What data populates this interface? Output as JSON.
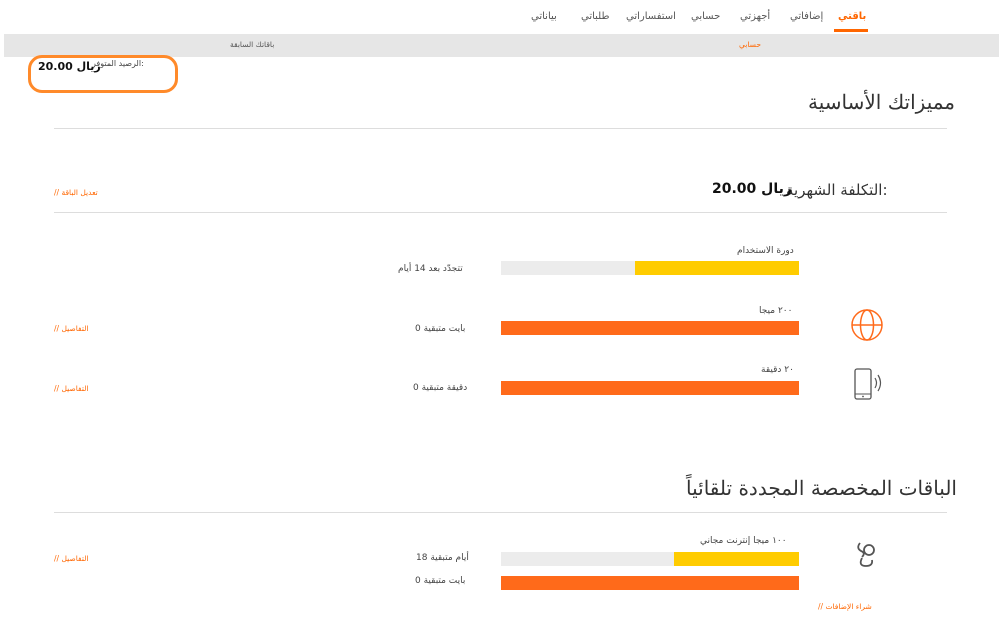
{
  "nav": {
    "tabs": [
      {
        "label": "باقتي",
        "active": true
      },
      {
        "label": "إضافاتي",
        "active": false
      },
      {
        "label": "أجهزتي",
        "active": false
      },
      {
        "label": "حسابي",
        "active": false
      },
      {
        "label": "استفساراتي",
        "active": false
      },
      {
        "label": "طلباتي",
        "active": false
      },
      {
        "label": "بياناتي",
        "active": false
      }
    ],
    "accent_color": "#ff6600"
  },
  "subnav": {
    "account": "حسابي",
    "previous_plans": "باقاتك السابقة"
  },
  "balance": {
    "label": "الرصيد المتوفر:",
    "value": "20.00 ريال"
  },
  "basic": {
    "title": "مميزاتك الأساسية",
    "monthly_cost_label": "التكلفة الشهرية:",
    "monthly_cost_value": "20.00 ريال",
    "edit_link": "// تعديل الباقة",
    "cycle": {
      "title": "دورة الاستخدام",
      "remaining": "تتجدّد بعد 14 أيام",
      "fill_fraction": 0.55,
      "fill_color": "#ffcc00"
    },
    "items": [
      {
        "icon": "globe-icon",
        "title": "٢٠٠ ميجا",
        "remaining": "0 بايت متبقية",
        "details": "// التفاصيل",
        "fill_fraction": 1.0,
        "fill_color": "#ff6a1a"
      },
      {
        "icon": "mobile-phone-icon",
        "title": "٢٠ دقيقة",
        "remaining": "0 دقيقة متبقية",
        "details": "// التفاصيل",
        "fill_fraction": 1.0,
        "fill_color": "#ff6a1a"
      }
    ]
  },
  "auto": {
    "title": "الباقات المخصصة المجددة تلقائياً",
    "item": {
      "icon": "operator-logo-icon",
      "title": "١٠٠ ميجا إنترنت مجاني",
      "days_remaining": "18 أيام متبقية",
      "days_fill_fraction": 0.42,
      "data_remaining": "0 بايت متبقية",
      "data_fill_fraction": 1.0,
      "details": "// التفاصيل",
      "buy_link": "// شراء الإضافات"
    }
  }
}
